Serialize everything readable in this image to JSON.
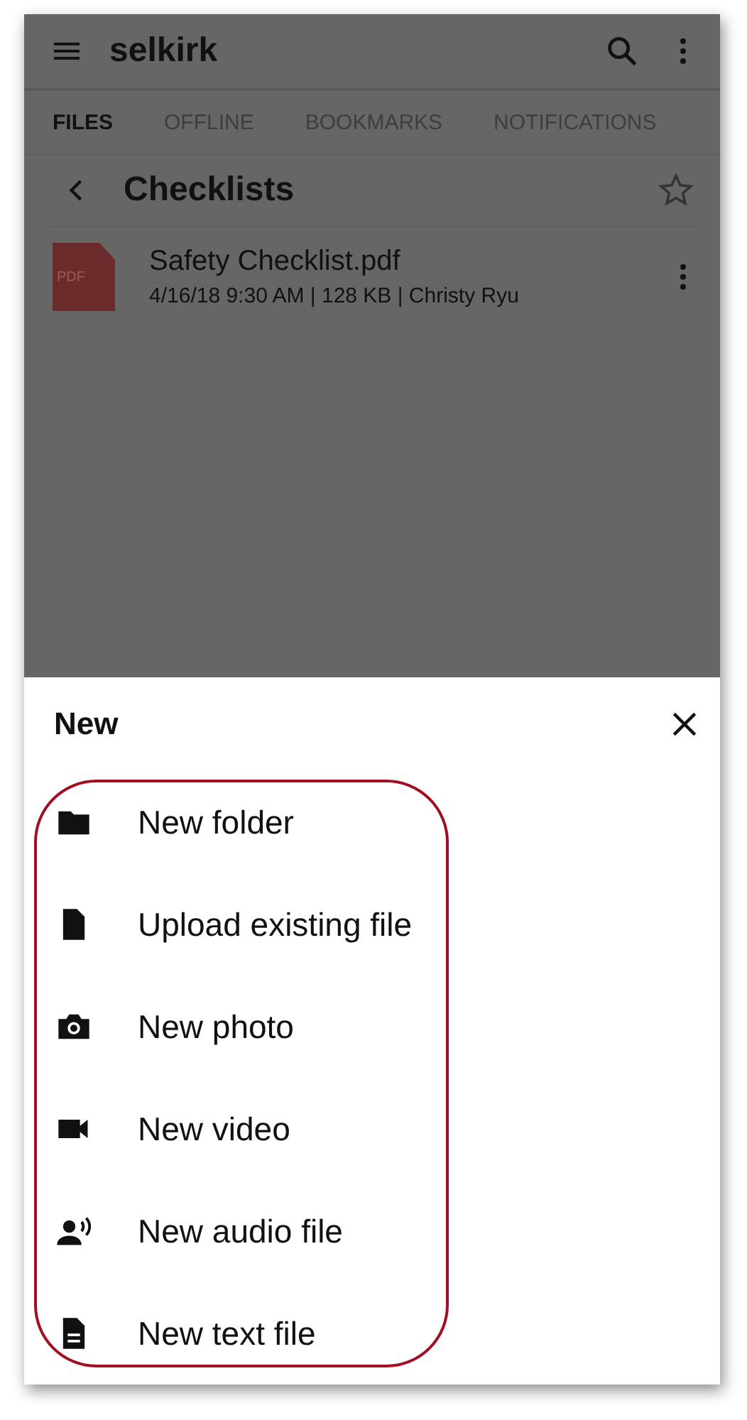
{
  "app_bar": {
    "title": "selkirk"
  },
  "tabs": [
    {
      "label": "FILES",
      "selected": true
    },
    {
      "label": "OFFLINE",
      "selected": false
    },
    {
      "label": "BOOKMARKS",
      "selected": false
    },
    {
      "label": "NOTIFICATIONS",
      "selected": false
    }
  ],
  "folder": {
    "title": "Checklists",
    "starred": false
  },
  "files": [
    {
      "badge": "PDF",
      "name": "Safety Checklist.pdf",
      "meta": "4/16/18  9:30 AM | 128 KB | Christy Ryu"
    }
  ],
  "sheet": {
    "title": "New",
    "items": [
      {
        "kind": "folder",
        "label": "New folder"
      },
      {
        "kind": "file",
        "label": "Upload existing file"
      },
      {
        "kind": "camera",
        "label": "New photo"
      },
      {
        "kind": "video",
        "label": "New video"
      },
      {
        "kind": "audio",
        "label": "New audio file"
      },
      {
        "kind": "text",
        "label": "New text file"
      }
    ]
  }
}
